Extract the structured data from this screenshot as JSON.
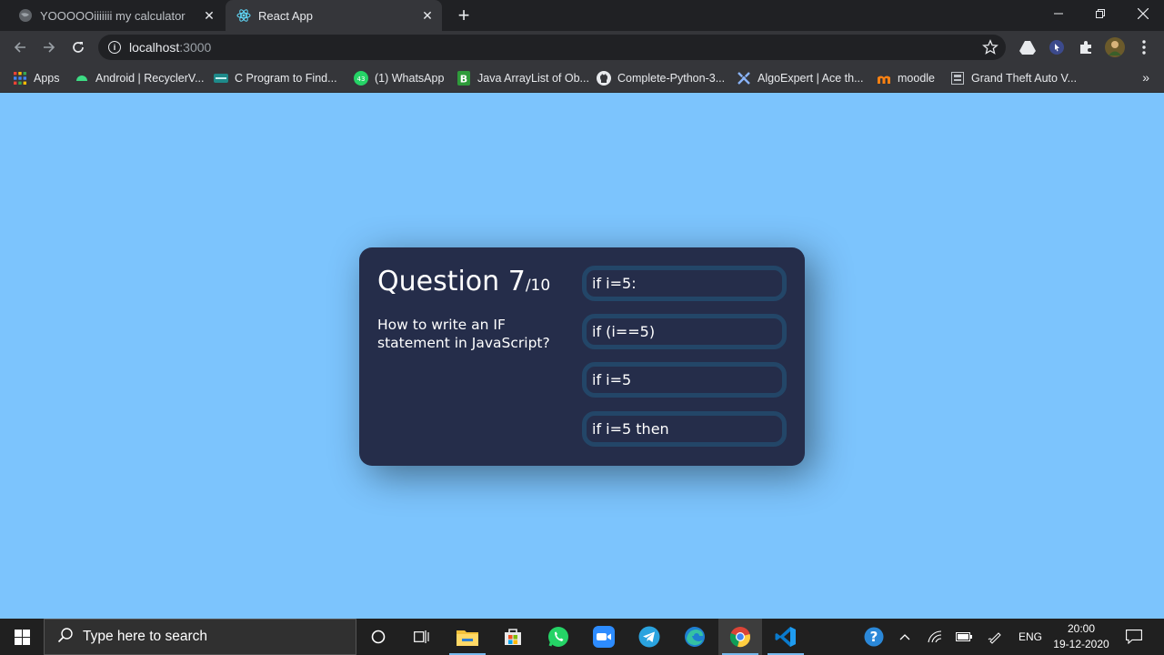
{
  "browser": {
    "tabs": [
      {
        "title": "YOOOOOiiiiiii my calculator",
        "active": false
      },
      {
        "title": "React App",
        "active": true
      }
    ],
    "address": {
      "host": "localhost",
      "port": ":3000"
    },
    "bookmarks": [
      {
        "label": "Apps",
        "icon": "apps-grid-icon"
      },
      {
        "label": "Android | RecyclerV...",
        "icon": "android-icon"
      },
      {
        "label": "C Program to Find...",
        "icon": "site-icon"
      },
      {
        "label": "(1) WhatsApp",
        "icon": "whatsapp-icon"
      },
      {
        "label": "Java ArrayList of Ob...",
        "icon": "bookmark-b-icon"
      },
      {
        "label": "Complete-Python-3...",
        "icon": "github-icon"
      },
      {
        "label": "AlgoExpert | Ace th...",
        "icon": "algoexpert-icon"
      },
      {
        "label": "moodle",
        "icon": "moodle-icon"
      },
      {
        "label": "Grand Theft Auto V...",
        "icon": "site-icon"
      }
    ],
    "whatsapp_badge": "43"
  },
  "quiz": {
    "question_label": "Question 7",
    "question_total": "/10",
    "question_text": "How to write an IF statement in JavaScript?",
    "answers": [
      "if i=5:",
      "if (i==5)",
      "if i=5",
      "if i=5 then"
    ]
  },
  "taskbar": {
    "search_placeholder": "Type here to search",
    "language": "ENG",
    "time": "20:00",
    "date": "19-12-2020"
  },
  "colors": {
    "page_background": "#7cc4fd",
    "card_background": "#252d4a",
    "answer_border": "#234668"
  }
}
